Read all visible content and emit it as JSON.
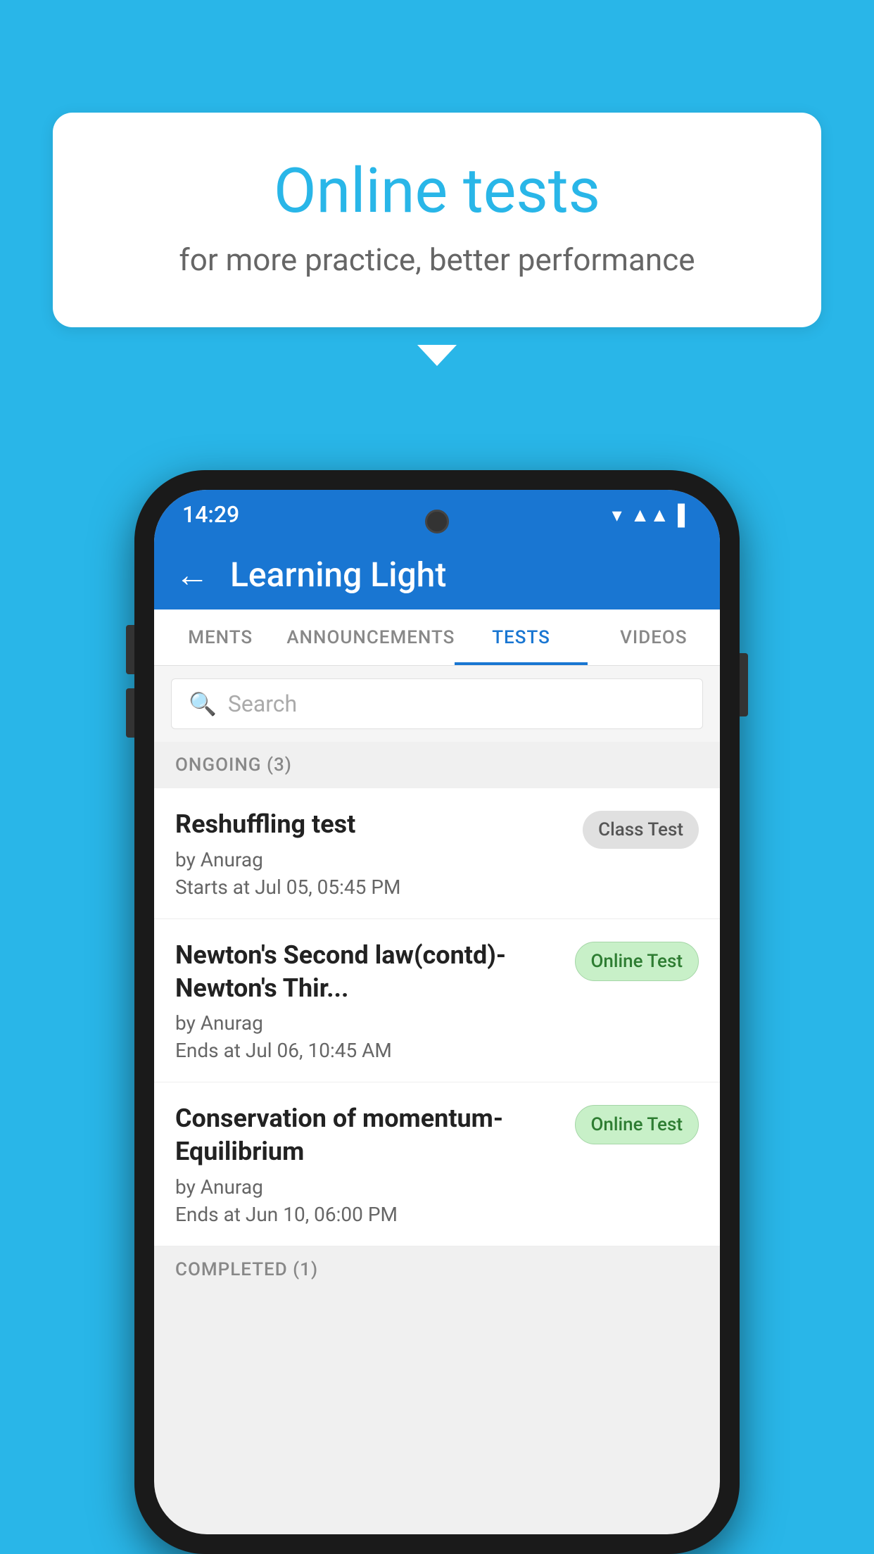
{
  "background_color": "#29B6E8",
  "bubble": {
    "title": "Online tests",
    "subtitle": "for more practice, better performance"
  },
  "phone": {
    "status_bar": {
      "time": "14:29",
      "icons": [
        "▾▾",
        "▲▲",
        "▌▌"
      ]
    },
    "app_bar": {
      "title": "Learning Light",
      "back_label": "←"
    },
    "tabs": [
      {
        "label": "MENTS",
        "active": false
      },
      {
        "label": "ANNOUNCEMENTS",
        "active": false
      },
      {
        "label": "TESTS",
        "active": true
      },
      {
        "label": "VIDEOS",
        "active": false
      }
    ],
    "search": {
      "placeholder": "Search"
    },
    "ongoing_section": {
      "header": "ONGOING (3)",
      "items": [
        {
          "title": "Reshuffling test",
          "by": "by Anurag",
          "time_label": "Starts at",
          "time_value": "Jul 05, 05:45 PM",
          "badge": "Class Test",
          "badge_type": "class"
        },
        {
          "title": "Newton's Second law(contd)-Newton's Thir...",
          "by": "by Anurag",
          "time_label": "Ends at",
          "time_value": "Jul 06, 10:45 AM",
          "badge": "Online Test",
          "badge_type": "online"
        },
        {
          "title": "Conservation of momentum-Equilibrium",
          "by": "by Anurag",
          "time_label": "Ends at",
          "time_value": "Jun 10, 06:00 PM",
          "badge": "Online Test",
          "badge_type": "online"
        }
      ]
    },
    "completed_section": {
      "header": "COMPLETED (1)"
    }
  }
}
